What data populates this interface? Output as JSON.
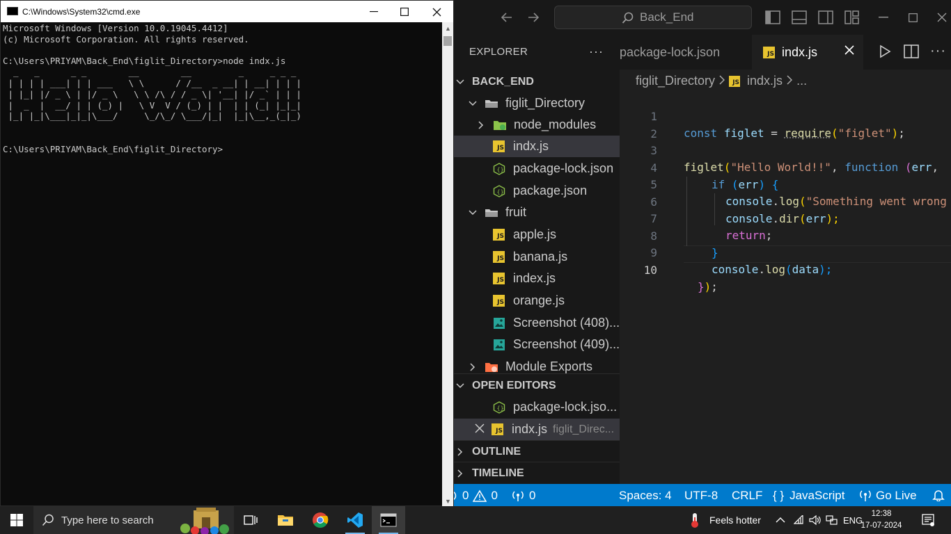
{
  "cmd": {
    "title": "C:\\Windows\\System32\\cmd.exe",
    "output": "Microsoft Windows [Version 10.0.19045.4412]\n(c) Microsoft Corporation. All rights reserved.\n\nC:\\Users\\PRIYAM\\Back_End\\figlit_Directory>node indx.js\n  _   _      _ _        __        __         _     _ _ _\n | | | | ___| | | ___   \\ \\      / /__  _ __| | __| | | |\n | |_| |/ _ \\ | |/ _ \\   \\ \\ /\\ / / _ \\| '__| |/ _` | | |\n |  _  |  __/ | | (_) |   \\ V  V / (_) | |  | | (_| |_|_|\n |_| |_|\\___|_|_|\\___/     \\_/\\_/ \\___/|_|  |_|\\__,_(_|_)\n\n\nC:\\Users\\PRIYAM\\Back_End\\figlit_Directory>"
  },
  "vscode": {
    "search_text": "Back_End",
    "explorer_title": "EXPLORER",
    "explorer_more": "···",
    "tree": {
      "root": "BACK_END",
      "figlit_directory": "figlit_Directory",
      "node_modules": "node_modules",
      "indx": "indx.js",
      "package_lock": "package-lock.json",
      "package": "package.json",
      "fruit": "fruit",
      "apple": "apple.js",
      "banana": "banana.js",
      "index": "index.js",
      "orange": "orange.js",
      "shot408": "Screenshot (408)...",
      "shot409": "Screenshot (409)...",
      "module_exports": "Module Exports"
    },
    "open_editors": {
      "title": "OPEN EDITORS",
      "item1": "package-lock.jso...",
      "item2": "indx.js",
      "item2_dir": "figlit_Direc..."
    },
    "outline": "OUTLINE",
    "timeline": "TIMELINE",
    "tabs": {
      "tab1": "package-lock.json",
      "tab2": "indx.js"
    },
    "breadcrumb": {
      "folder": "figlit_Directory",
      "file": "indx.js",
      "more": "..."
    },
    "line_numbers": [
      "1",
      "2",
      "3",
      "4",
      "5",
      "6",
      "7",
      "8",
      "9",
      "10"
    ],
    "code": {
      "l1_const": "const",
      "l1_name": "figlet",
      "l1_eq": " = ",
      "l1_req": "require",
      "l1_p1": "(",
      "l1_str": "\"figlet\"",
      "l1_p2": ")",
      "l1_semi": ";",
      "l3_fn": "figlet",
      "l3_p1": "(",
      "l3_str": "\"Hello World!!\"",
      "l3_comma": ", ",
      "l3_kw": "function",
      "l3_p2": " (",
      "l3_arg": "err",
      "l3_rest": ",",
      "l4_if": "if",
      "l4_p1": " (",
      "l4_var": "err",
      "l4_p2": ") {",
      "l5_obj": "console",
      "l5_dot": ".",
      "l5_fn": "log",
      "l5_p": "(",
      "l5_str": "\"Something went wrong",
      "l6_obj": "console",
      "l6_dot": ".",
      "l6_fn": "dir",
      "l6_p1": "(",
      "l6_var": "err",
      "l6_p2": ");",
      "l7_kw": "return",
      "l7_semi": ";",
      "l8_brace": "}",
      "l9_obj": "console",
      "l9_dot": ".",
      "l9_fn": "log",
      "l9_p1": "(",
      "l9_var": "data",
      "l9_p2": ");",
      "l10_b": "}",
      "l10_p": ")",
      "l10_semi": ";"
    },
    "status": {
      "errors": "0",
      "warnings": "0",
      "ports": "0",
      "spaces": "Spaces: 4",
      "encoding": "UTF-8",
      "eol": "CRLF",
      "braces": "{ }",
      "language": "JavaScript",
      "golive": "Go Live"
    }
  },
  "taskbar": {
    "search_placeholder": "Type here to search",
    "weather": "Feels hotter",
    "lang": "ENG",
    "time": "12:38",
    "date": "17-07-2024"
  },
  "colors": {
    "vscode_accent": "#007acc",
    "js_icon": "#e8c42f",
    "json_icon": "#8dc149"
  }
}
